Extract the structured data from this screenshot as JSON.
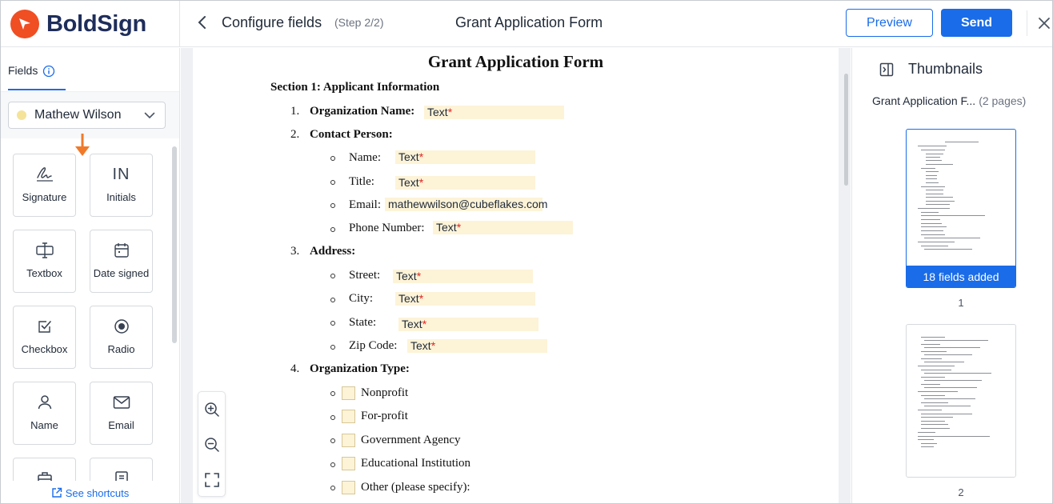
{
  "header": {
    "logo_text": "BoldSign",
    "title": "Configure fields",
    "step": "(Step 2/2)",
    "document_title": "Grant Application Form",
    "preview_label": "Preview",
    "send_label": "Send"
  },
  "sidebar": {
    "tab_label": "Fields",
    "signer": {
      "name": "Mathew Wilson",
      "color": "#f5e39a"
    },
    "fields": [
      {
        "label": "Signature",
        "icon": "signature-icon"
      },
      {
        "label": "Initials",
        "icon": "initials-icon"
      },
      {
        "label": "Textbox",
        "icon": "textbox-icon"
      },
      {
        "label": "Date signed",
        "icon": "calendar-icon"
      },
      {
        "label": "Checkbox",
        "icon": "checkbox-icon"
      },
      {
        "label": "Radio",
        "icon": "radio-icon"
      },
      {
        "label": "Name",
        "icon": "person-icon"
      },
      {
        "label": "Email",
        "icon": "mail-icon"
      }
    ],
    "initials_glyph": "IN",
    "shortcuts_label": "See shortcuts"
  },
  "document": {
    "title": "Grant Application Form",
    "section1": "Section 1: Applicant Information",
    "items": {
      "org_name": {
        "num": "1.",
        "label": "Organization Name:",
        "field": "Text"
      },
      "contact": {
        "num": "2.",
        "label": "Contact Person:"
      },
      "name": {
        "label": "Name:",
        "field": "Text"
      },
      "title": {
        "label": "Title:",
        "field": "Text"
      },
      "email": {
        "label": "Email:",
        "field": "mathewwilson@cubeflakes.com"
      },
      "phone": {
        "label": "Phone Number:",
        "field": "Text"
      },
      "address": {
        "num": "3.",
        "label": "Address:"
      },
      "street": {
        "label": "Street:",
        "field": "Text"
      },
      "city": {
        "label": "City:",
        "field": "Text"
      },
      "state": {
        "label": "State:",
        "field": "Text"
      },
      "zip": {
        "label": "Zip Code:",
        "field": "Text"
      },
      "org_type": {
        "num": "4.",
        "label": "Organization Type:"
      },
      "nonprofit": "Nonprofit",
      "forprofit": "For-profit",
      "government": "Government Agency",
      "educational": "Educational Institution",
      "other": "Other (please specify):"
    },
    "required_mark": "*"
  },
  "thumbnails": {
    "title": "Thumbnails",
    "doc_name": "Grant Application F...",
    "pages_label": "(2 pages)",
    "page1_badge": "18 fields added",
    "page1_num": "1",
    "page2_num": "2"
  },
  "colors": {
    "accent": "#1a6ce8",
    "logo": "#f04e23",
    "field_fill": "#fdf3d7",
    "drag_arrow": "#f07a2a"
  }
}
